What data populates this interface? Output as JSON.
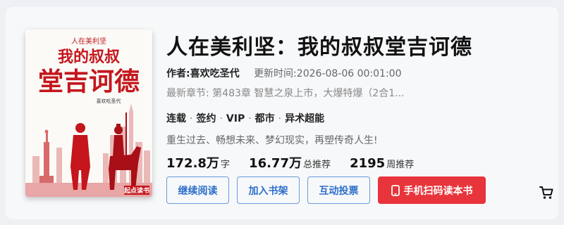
{
  "book": {
    "title": "人在美利坚：我的叔叔堂吉诃德",
    "author_label": "作者:",
    "author": "喜欢吃圣代",
    "update_label": "更新时间:",
    "update_time": "2026-08-06 00:01:00",
    "latest_chapter": "最新章节: 第483章 智慧之泉上市，大爆特爆（2合1...",
    "tags": [
      "连载",
      "签约",
      "VIP",
      "都市",
      "异术超能"
    ],
    "intro": "重生过去、畅想未来、梦幻现实，再塑传奇人生!",
    "stats": {
      "words_num": "172.8万",
      "words_unit": "字",
      "total_rec_num": "16.77万",
      "total_rec_unit": "总推荐",
      "week_rec_num": "2195",
      "week_rec_unit": "周推荐"
    }
  },
  "cover": {
    "top_line": "人在美利坚",
    "title_line1": "我的叔叔",
    "title_line2": "堂吉诃德",
    "author_line": "喜欢吃圣代",
    "badge": "起点读书",
    "accent_color": "#d42020"
  },
  "buttons": {
    "read": "继续阅读",
    "shelf": "加入书架",
    "vote": "互动投票",
    "mobile": "手机扫码读本书"
  },
  "icons": {
    "phone": "mobile-phone-icon",
    "cart": "shopping-cart-icon"
  },
  "colors": {
    "primary_red": "#e8343b",
    "link_blue": "#2d6fcc"
  }
}
